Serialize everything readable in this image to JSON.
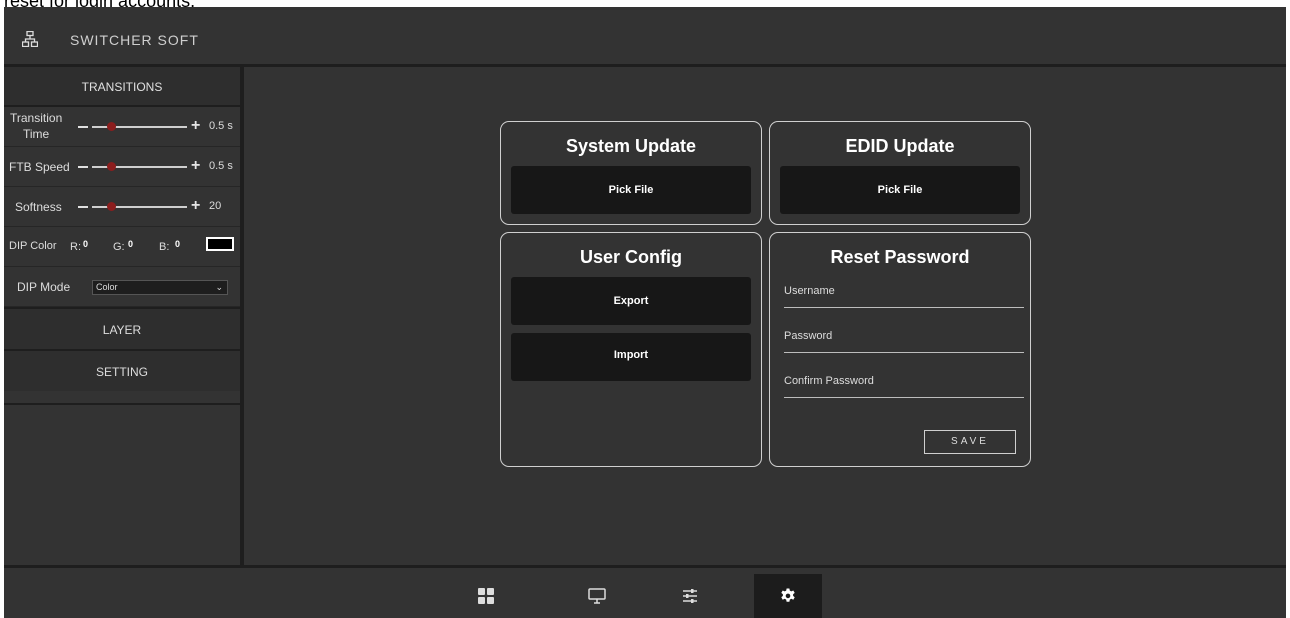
{
  "caption": "reset for login accounts.",
  "app": {
    "title": "SWITCHER SOFT",
    "logo_icon": "network-icon"
  },
  "sidebar": {
    "transitions_label": "TRANSITIONS",
    "transition_time": {
      "label_line1": "Transition",
      "label_line2": "Time",
      "value": "0.5 s",
      "level": 0.2
    },
    "ftb_speed": {
      "label": "FTB Speed",
      "value": "0.5 s",
      "level": 0.2
    },
    "softness": {
      "label": "Softness",
      "value": "20",
      "level": 0.2
    },
    "dip_color": {
      "label": "DIP Color",
      "r_label": "R:",
      "r": "0",
      "g_label": "G:",
      "g": "0",
      "b_label": "B:",
      "b": "0",
      "swatch_color": "#000000"
    },
    "dip_mode": {
      "label": "DIP Mode",
      "selected": "Color"
    },
    "layer_label": "LAYER",
    "setting_label": "SETTING"
  },
  "main": {
    "system_update": {
      "title": "System Update",
      "button": "Pick File"
    },
    "edid_update": {
      "title": "EDID Update",
      "button": "Pick File"
    },
    "user_config": {
      "title": "User Config",
      "export": "Export",
      "import": "Import"
    },
    "reset_password": {
      "title": "Reset Password",
      "username": "Username",
      "password": "Password",
      "confirm": "Confirm Password",
      "save": "SAVE"
    }
  },
  "bottom_nav": {
    "items": [
      "grid-icon",
      "monitor-icon",
      "sliders-icon",
      "gear-icon"
    ],
    "active": "gear-icon"
  }
}
